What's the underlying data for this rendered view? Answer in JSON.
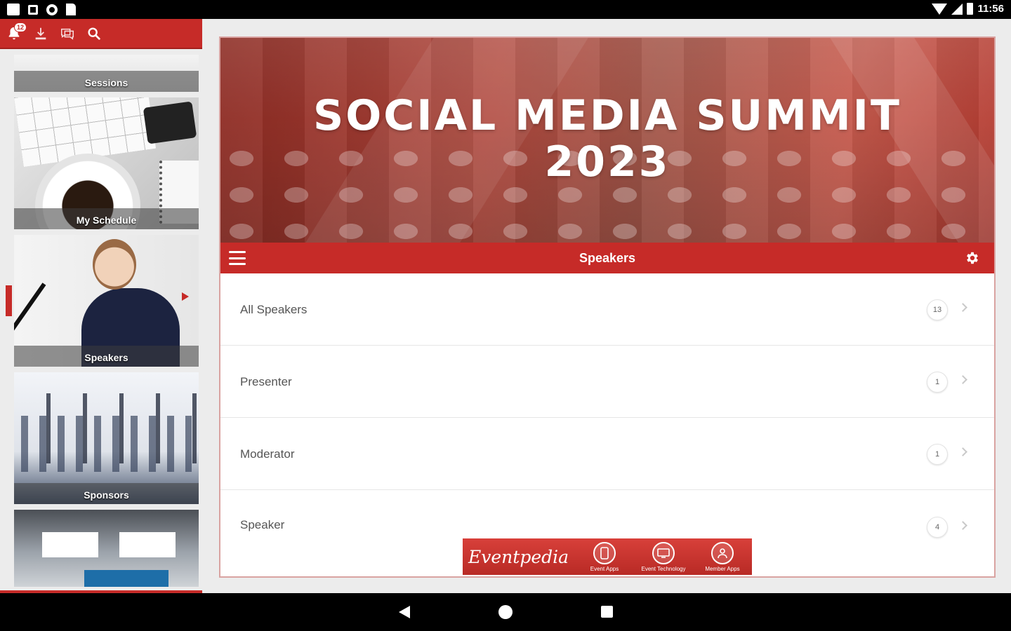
{
  "status_bar": {
    "time": "11:56"
  },
  "sidebar": {
    "toolbar": {
      "notification_count": "12"
    },
    "tiles": [
      {
        "label": "Sessions"
      },
      {
        "label": "My Schedule"
      },
      {
        "label": "Speakers"
      },
      {
        "label": "Sponsors"
      }
    ]
  },
  "banner": {
    "line1": "SOCIAL MEDIA SUMMIT",
    "line2": "2023"
  },
  "titlebar": {
    "title": "Speakers"
  },
  "speaker_groups": [
    {
      "label": "All Speakers",
      "count": "13"
    },
    {
      "label": "Presenter",
      "count": "1"
    },
    {
      "label": "Moderator",
      "count": "1"
    },
    {
      "label": "Speaker",
      "count": "4"
    }
  ],
  "ad": {
    "brand": "Eventpedia",
    "items": [
      {
        "label": "Event Apps"
      },
      {
        "label": "Event Technology"
      },
      {
        "label": "Member Apps"
      }
    ]
  },
  "colors": {
    "accent": "#c62b28"
  },
  "icons": [
    "bell-icon",
    "download-icon",
    "chat-icon",
    "search-icon",
    "menu-icon",
    "gear-icon",
    "chevron-right-icon"
  ]
}
